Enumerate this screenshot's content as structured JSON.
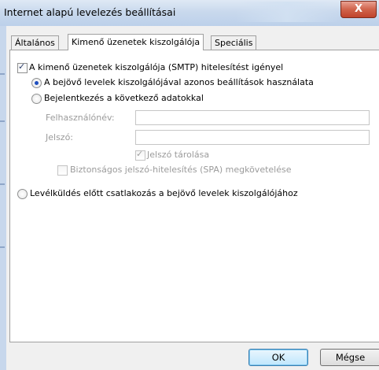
{
  "window": {
    "title": "Internet alapú levelezés beállításai",
    "close_glyph": "X"
  },
  "tabs": [
    {
      "label": "Általános",
      "active": false
    },
    {
      "label": "Kimenő üzenetek kiszolgálója",
      "active": true
    },
    {
      "label": "Speciális",
      "active": false
    }
  ],
  "smtp_auth": {
    "label": "A kimenő üzenetek kiszolgálója (SMTP) hitelesítést igényel",
    "checked": true
  },
  "options": {
    "same_settings": {
      "label": "A bejövő levelek kiszolgálójával azonos beállítások használata",
      "selected": true
    },
    "login_with": {
      "label": "Bejelentkezés a következő adatokkal",
      "selected": false
    }
  },
  "fields": {
    "username": {
      "label": "Felhasználónév:",
      "value": ""
    },
    "password": {
      "label": "Jelszó:",
      "value": ""
    }
  },
  "remember_password": {
    "label": "Jelszó tárolása",
    "checked": true
  },
  "spa": {
    "label": "Biztonságos jelszó-hitelesítés (SPA) megkövetelése",
    "checked": false
  },
  "connect_first": {
    "label": "Levélküldés előtt csatlakozás a bejövő levelek kiszolgálójához",
    "selected": false
  },
  "buttons": {
    "ok": "OK",
    "cancel": "Mégse"
  }
}
